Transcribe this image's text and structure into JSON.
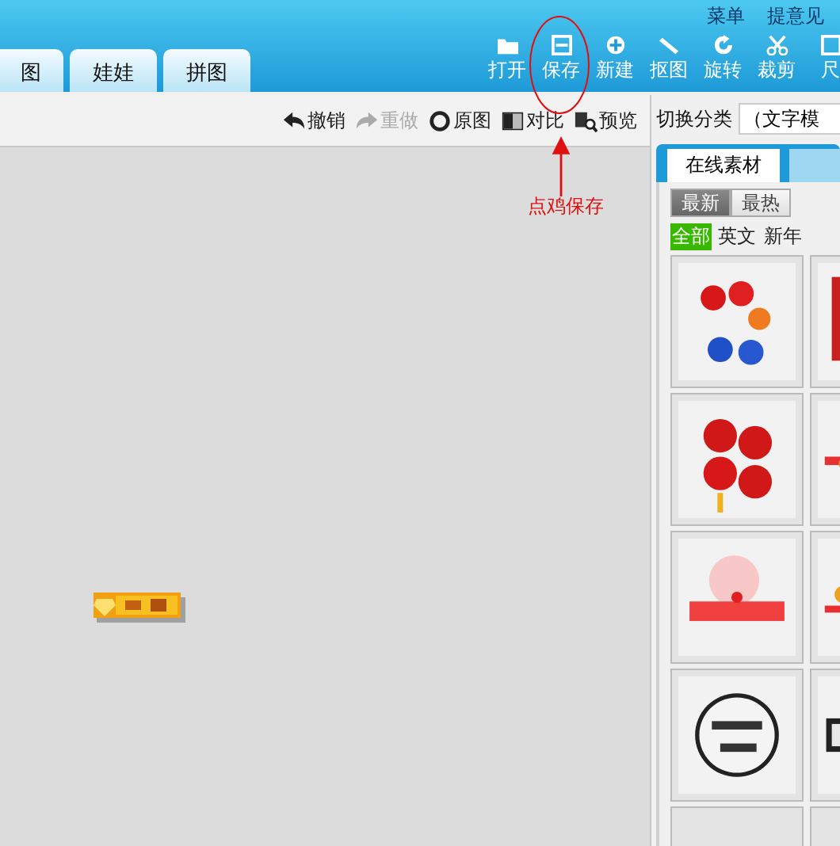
{
  "top_links": [
    "菜单",
    "提意见"
  ],
  "tabs": [
    {
      "label": "图",
      "selected": false
    },
    {
      "label": "娃娃",
      "selected": false
    },
    {
      "label": "拼图",
      "selected": false
    }
  ],
  "toolbar": [
    {
      "label": "打开",
      "kind": "folder"
    },
    {
      "label": "保存",
      "kind": "save"
    },
    {
      "label": "新建",
      "kind": "plus"
    },
    {
      "label": "抠图",
      "kind": "pen"
    },
    {
      "label": "旋转",
      "kind": "rotate"
    },
    {
      "label": "裁剪",
      "kind": "scissors"
    },
    {
      "label": "尺",
      "kind": "frame"
    }
  ],
  "annotation": {
    "text": "点鸡保存"
  },
  "edit_tools": [
    {
      "label": "撤销",
      "kind": "undo",
      "disabled": false
    },
    {
      "label": "重做",
      "kind": "redo",
      "disabled": true
    },
    {
      "label": "原图",
      "kind": "original",
      "disabled": false
    },
    {
      "label": "对比",
      "kind": "compare",
      "disabled": false
    },
    {
      "label": "预览",
      "kind": "preview",
      "disabled": false
    }
  ],
  "canvas": {
    "sticker": {
      "kind": "picture"
    }
  },
  "panel": {
    "category_label": "切换分类",
    "category_value": "（文字模",
    "tabs": [
      {
        "label": "在线素材",
        "selected": true
      },
      {
        "selected": false
      }
    ],
    "sort": [
      {
        "label": "最新",
        "selected": true
      },
      {
        "label": "最热",
        "selected": false
      }
    ],
    "filters": [
      {
        "label": "全部",
        "selected": true
      },
      {
        "label": "英文",
        "selected": false
      },
      {
        "label": "新年",
        "selected": false
      }
    ],
    "thumbnails": [
      {
        "kind": "picture"
      },
      {
        "kind": "picture"
      },
      {
        "kind": "picture"
      },
      {
        "kind": "picture"
      },
      {
        "kind": "picture"
      },
      {
        "kind": "picture"
      },
      {
        "kind": "picture"
      },
      {
        "kind": "picture"
      },
      {
        "kind": "blank"
      },
      {
        "kind": "blank"
      }
    ]
  }
}
